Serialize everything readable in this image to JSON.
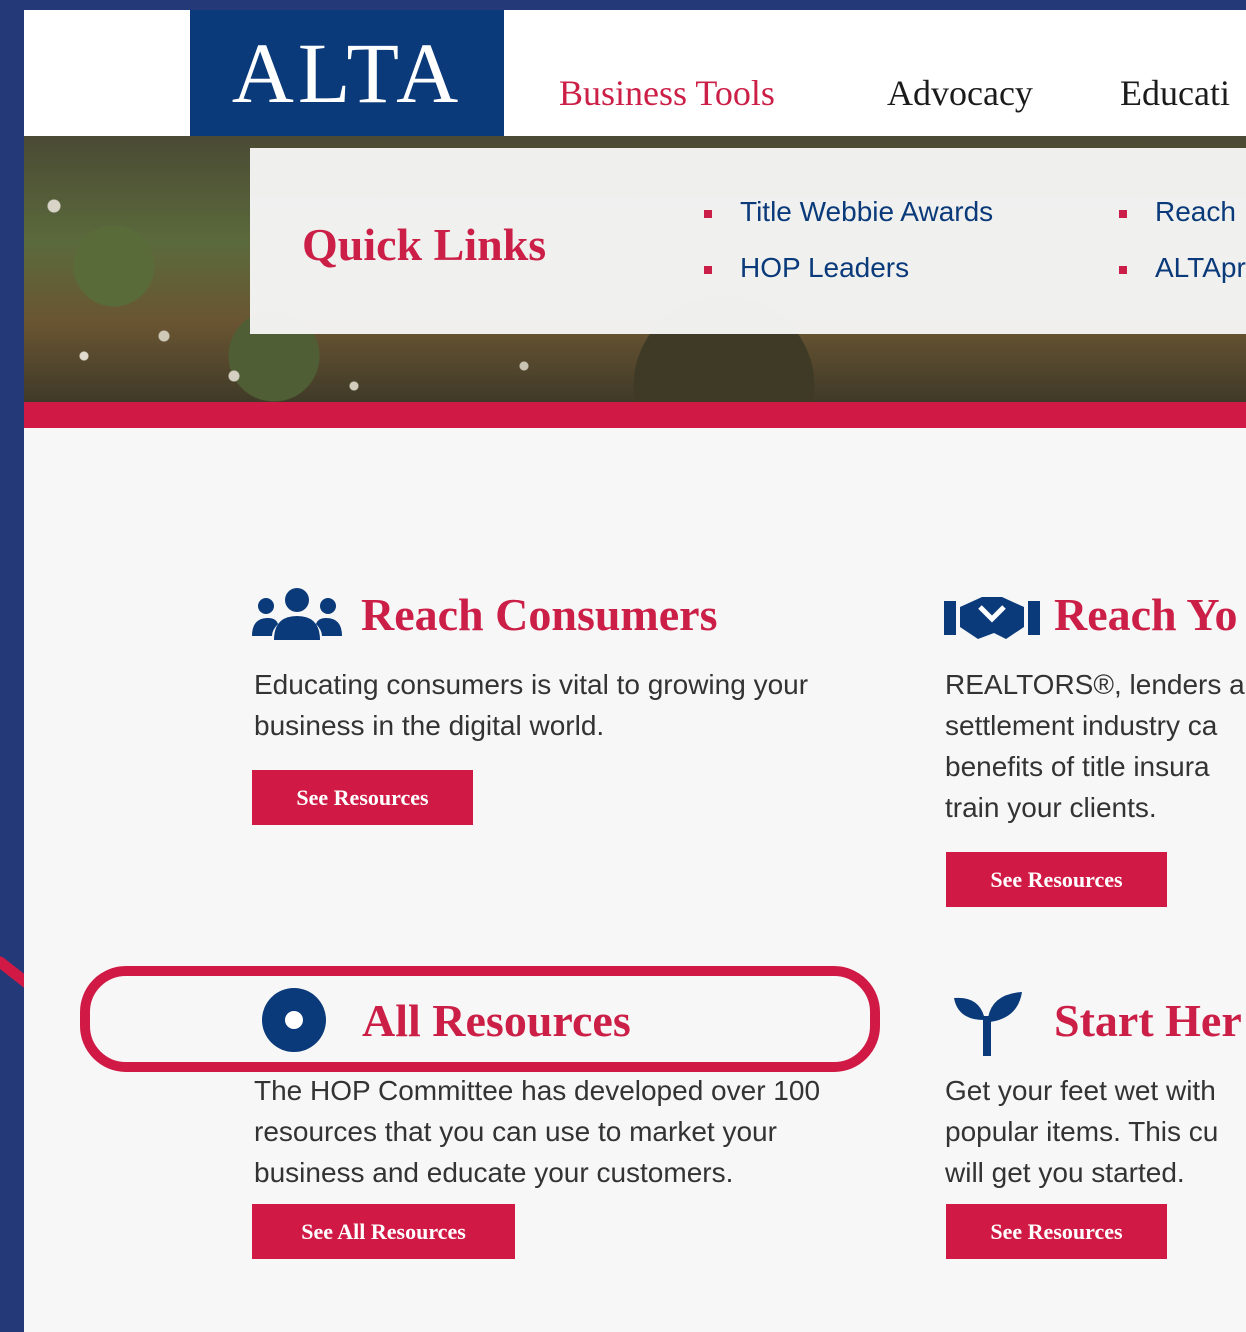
{
  "header": {
    "logo_text": "ALTA",
    "nav": [
      "Business Tools",
      "Advocacy",
      "Educati"
    ]
  },
  "quick_links": {
    "title": "Quick Links",
    "links": [
      "Title Webbie Awards",
      "HOP Leaders",
      "Reach",
      "ALTApr"
    ]
  },
  "sections": [
    {
      "title": "Reach Consumers",
      "icon": "users-icon",
      "lines": [
        "Educating consumers is vital to growing your",
        "business in the digital world."
      ],
      "button": "See Resources"
    },
    {
      "title": "Reach Yo",
      "icon": "handshake-icon",
      "lines": [
        "REALTORS®, lenders a",
        "settlement industry ca",
        "benefits of title insura",
        "train your clients."
      ],
      "button": "See Resources"
    },
    {
      "title": "All Resources",
      "icon": "target-circle-icon",
      "lines": [
        "The HOP Committee has developed over 100",
        "resources that you can use to market your",
        "business and educate your customers."
      ],
      "button": "See All Resources"
    },
    {
      "title": "Start Her",
      "icon": "sprout-icon",
      "lines": [
        "Get your feet wet with",
        "popular items. This cu",
        "will get you started."
      ],
      "button": "See Resources"
    }
  ],
  "colors": {
    "brand_navy": "#0a3a7a",
    "brand_red": "#d01a45",
    "border_navy": "#243a78"
  }
}
